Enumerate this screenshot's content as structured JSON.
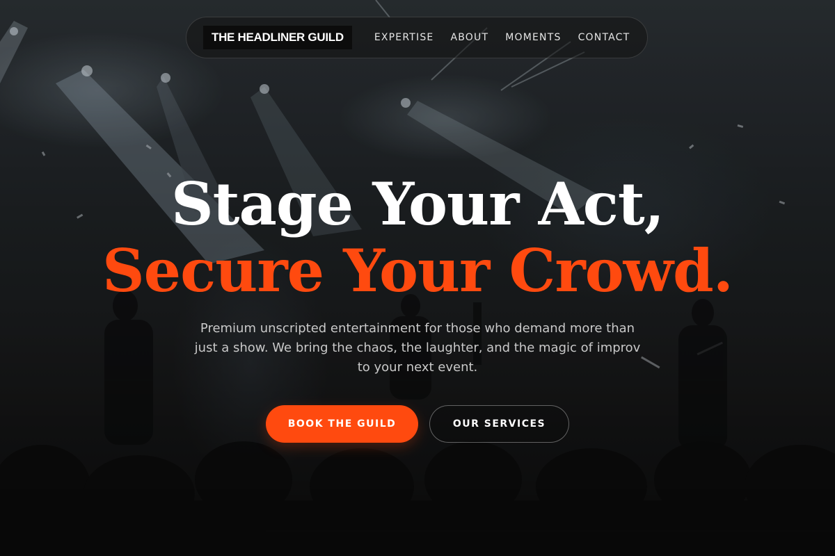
{
  "nav": {
    "brand": "THE HEADLINER GUILD",
    "links": [
      "EXPERTISE",
      "ABOUT",
      "MOMENTS",
      "CONTACT"
    ]
  },
  "hero": {
    "headline_line1": "Stage Your Act,",
    "headline_line2": "Secure Your Crowd.",
    "subtitle": "Premium unscripted entertainment for those who demand more than just a show. We bring the chaos, the laughter, and the magic of improv to your next event.",
    "primary_button": "BOOK THE GUILD",
    "secondary_button": "OUR SERVICES"
  },
  "colors": {
    "accent": "#ff4a0f",
    "background": "#141414",
    "text": "#ffffff"
  }
}
